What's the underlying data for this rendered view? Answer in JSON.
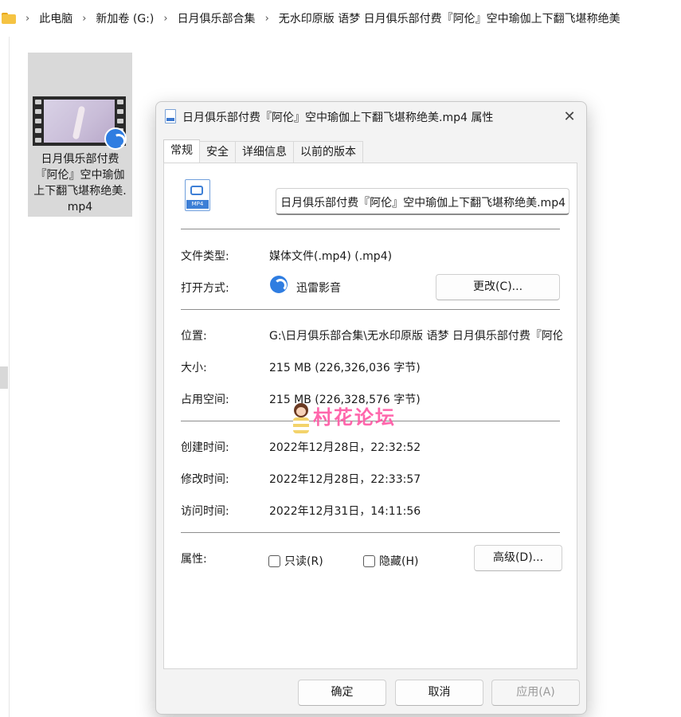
{
  "breadcrumb": {
    "items": [
      "此电脑",
      "新加卷 (G:)",
      "日月俱乐部合集",
      "无水印原版 语梦 日月俱乐部付费『阿伦』空中瑜伽上下翻飞堪称绝美"
    ]
  },
  "file_tile": {
    "label": "日月俱乐部付费『阿伦』空中瑜伽上下翻飞堪称绝美.mp4"
  },
  "dialog": {
    "title": "日月俱乐部付费『阿伦』空中瑜伽上下翻飞堪称绝美.mp4 属性",
    "tabs": [
      "常规",
      "安全",
      "详细信息",
      "以前的版本"
    ],
    "icon_badge": "MP4",
    "filename_value": "日月俱乐部付费『阿伦』空中瑜伽上下翻飞堪称绝美.mp4",
    "file_type_label": "文件类型:",
    "file_type_value": "媒体文件(.mp4) (.mp4)",
    "open_with_label": "打开方式:",
    "open_with_value": "迅雷影音",
    "change_button": "更改(C)...",
    "location_label": "位置:",
    "location_value": "G:\\日月俱乐部合集\\无水印原版 语梦 日月俱乐部付费『阿伦』空中瑜伽上下翻飞堪称绝美",
    "size_label": "大小:",
    "size_value": "215 MB (226,326,036 字节)",
    "size_on_disk_label": "占用空间:",
    "size_on_disk_value": "215 MB (226,328,576 字节)",
    "created_label": "创建时间:",
    "created_value": "2022年12月28日，22:32:52",
    "modified_label": "修改时间:",
    "modified_value": "2022年12月28日，22:33:57",
    "accessed_label": "访问时间:",
    "accessed_value": "2022年12月31日，14:11:56",
    "attributes_label": "属性:",
    "readonly_label": "只读(R)",
    "hidden_label": "隐藏(H)",
    "advanced_button": "高级(D)...",
    "ok_button": "确定",
    "cancel_button": "取消",
    "apply_button": "应用(A)"
  },
  "watermark": {
    "text": "村花论坛"
  },
  "colors": {
    "accent": "#2f7de1",
    "watermark": "#ff5aa5",
    "folder": "#f5c342"
  }
}
